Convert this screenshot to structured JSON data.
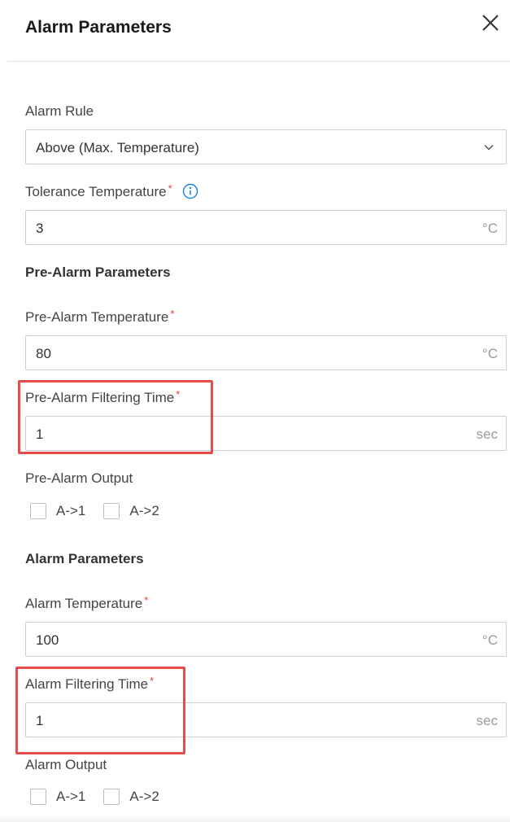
{
  "dialog": {
    "title": "Alarm Parameters"
  },
  "alarm_rule": {
    "label": "Alarm Rule",
    "value": "Above (Max. Temperature)"
  },
  "tolerance": {
    "label": "Tolerance Temperature",
    "required_mark": "*",
    "value": "3",
    "unit": "°C"
  },
  "pre_alarm": {
    "section_title": "Pre-Alarm Parameters",
    "temperature": {
      "label": "Pre-Alarm Temperature",
      "required_mark": "*",
      "value": "80",
      "unit": "°C"
    },
    "filtering_time": {
      "label": "Pre-Alarm Filtering Time",
      "required_mark": "*",
      "value": "1",
      "unit": "sec"
    },
    "output": {
      "label": "Pre-Alarm Output",
      "options": [
        "A->1",
        "A->2"
      ],
      "checked": [
        false,
        false
      ]
    }
  },
  "alarm": {
    "section_title": "Alarm Parameters",
    "temperature": {
      "label": "Alarm Temperature",
      "required_mark": "*",
      "value": "100",
      "unit": "°C"
    },
    "filtering_time": {
      "label": "Alarm Filtering Time",
      "required_mark": "*",
      "value": "1",
      "unit": "sec"
    },
    "output": {
      "label": "Alarm Output",
      "options": [
        "A->1",
        "A->2"
      ],
      "checked": [
        false,
        false
      ]
    }
  },
  "colors": {
    "highlight": "#e74c4c",
    "required": "#e53935",
    "info": "#1e88e5",
    "border": "#cfcfcf"
  }
}
